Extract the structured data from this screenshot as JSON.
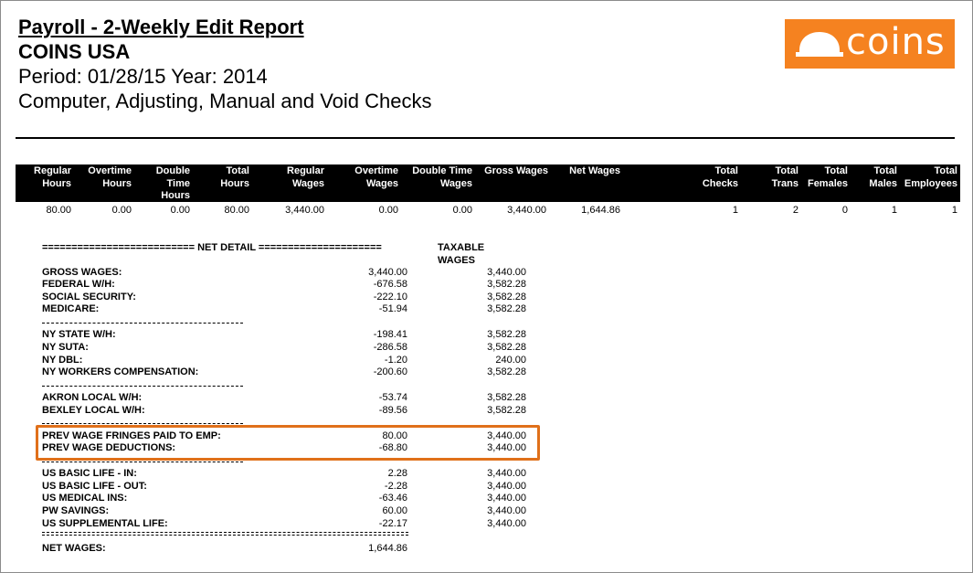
{
  "report": {
    "title": "Payroll - 2-Weekly Edit Report",
    "company": "COINS USA",
    "period": "Period: 01/28/15 Year: 2014",
    "subtitle": "Computer, Adjusting, Manual and Void Checks",
    "logo_text": "coins"
  },
  "summary": {
    "headers": [
      "Regular Hours",
      "Overtime Hours",
      "Double Time Hours",
      "Total Hours",
      "Regular Wages",
      "Overtime Wages",
      "Double Time Wages",
      "Gross Wages",
      "Net Wages",
      "Total Checks",
      "Total Trans",
      "Total Females",
      "Total Males",
      "Total Employees"
    ],
    "values": [
      "80.00",
      "0.00",
      "0.00",
      "80.00",
      "3,440.00",
      "0.00",
      "0.00",
      "3,440.00",
      "1,644.86",
      "1",
      "2",
      "0",
      "1",
      "1"
    ]
  },
  "net_detail": {
    "header": "========================== NET DETAIL =====================",
    "taxable_header": "TAXABLE WAGES",
    "rows": [
      {
        "label": "GROSS WAGES:",
        "amount": "3,440.00",
        "taxable": "3,440.00"
      },
      {
        "label": "FEDERAL W/H:",
        "amount": "-676.58",
        "taxable": "3,582.28"
      },
      {
        "label": "SOCIAL SECURITY:",
        "amount": "-222.10",
        "taxable": "3,582.28"
      },
      {
        "label": "MEDICARE:",
        "amount": "-51.94",
        "taxable": "3,582.28"
      },
      {
        "label": "NY STATE W/H:",
        "amount": "-198.41",
        "taxable": "3,582.28"
      },
      {
        "label": "NY SUTA:",
        "amount": "-286.58",
        "taxable": "3,582.28"
      },
      {
        "label": "NY DBL:",
        "amount": "-1.20",
        "taxable": "240.00"
      },
      {
        "label": "NY WORKERS COMPENSATION:",
        "amount": "-200.60",
        "taxable": "3,582.28"
      },
      {
        "label": "AKRON LOCAL W/H:",
        "amount": "-53.74",
        "taxable": "3,582.28"
      },
      {
        "label": "BEXLEY LOCAL W/H:",
        "amount": "-89.56",
        "taxable": "3,582.28"
      },
      {
        "label": "PREV WAGE FRINGES PAID TO EMP:",
        "amount": "80.00",
        "taxable": "3,440.00"
      },
      {
        "label": "PREV WAGE DEDUCTIONS:",
        "amount": "-68.80",
        "taxable": "3,440.00"
      },
      {
        "label": "US BASIC LIFE - IN:",
        "amount": "2.28",
        "taxable": "3,440.00"
      },
      {
        "label": "US BASIC LIFE - OUT:",
        "amount": "-2.28",
        "taxable": "3,440.00"
      },
      {
        "label": "US MEDICAL INS:",
        "amount": "-63.46",
        "taxable": "3,440.00"
      },
      {
        "label": "PW SAVINGS:",
        "amount": "60.00",
        "taxable": "3,440.00"
      },
      {
        "label": "US SUPPLEMENTAL LIFE:",
        "amount": "-22.17",
        "taxable": "3,440.00"
      }
    ],
    "net": {
      "label": "NET WAGES:",
      "amount": "1,644.86"
    }
  },
  "colors": {
    "logo_bg": "#f58220",
    "highlight": "#e0701a",
    "header_band": "#000000"
  }
}
